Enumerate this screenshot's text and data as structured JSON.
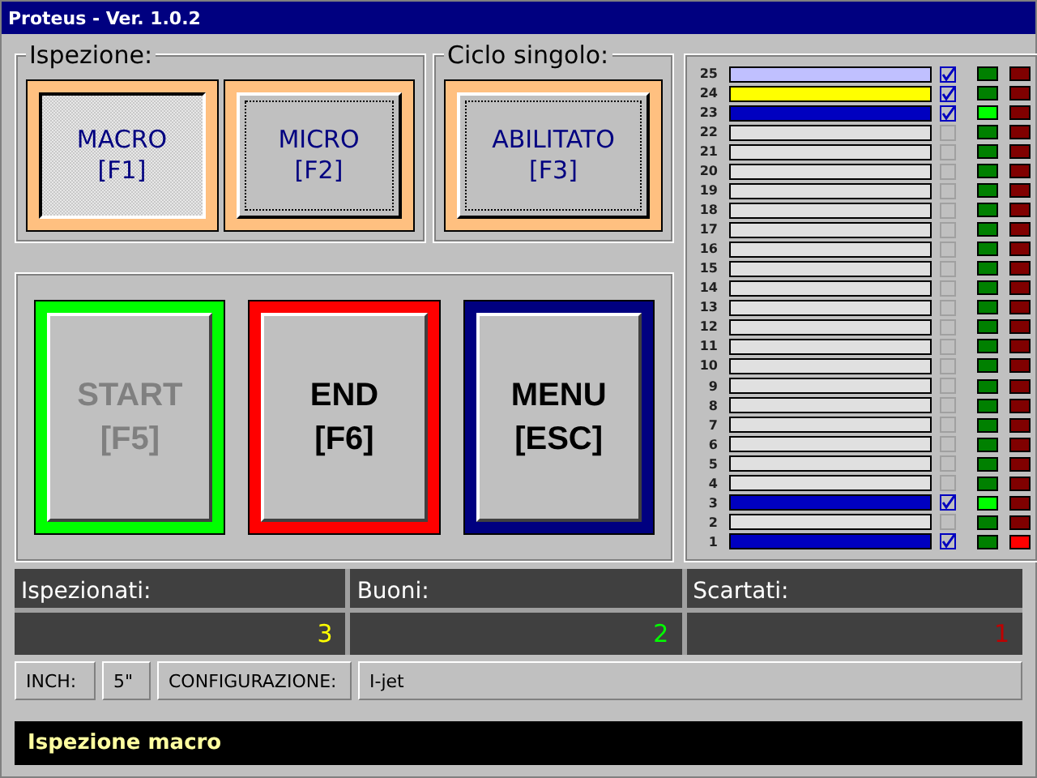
{
  "window": {
    "title": "Proteus - Ver. 1.0.2"
  },
  "inspection": {
    "label": "Ispezione:",
    "buttons": [
      {
        "label": "MACRO",
        "key": "[F1]",
        "selected": true
      },
      {
        "label": "MICRO",
        "key": "[F2]",
        "selected": false
      }
    ]
  },
  "single_cycle": {
    "label": "Ciclo singolo:",
    "button": {
      "label": "ABILITATO",
      "key": "[F3]"
    }
  },
  "actions": [
    {
      "label": "START",
      "key": "[F5]",
      "color": "#00ff00",
      "disabled": true
    },
    {
      "label": "END",
      "key": "[F6]",
      "color": "#ff0000",
      "disabled": false
    },
    {
      "label": "MENU",
      "key": "[ESC]",
      "color": "#000080",
      "disabled": false
    }
  ],
  "channels": [
    {
      "name": "25",
      "color": "#c0c0ff",
      "checked": true,
      "ok": false,
      "fail": false
    },
    {
      "name": "24",
      "color": "#ffff00",
      "checked": true,
      "ok": false,
      "fail": false
    },
    {
      "name": "23",
      "color": "#0000c0",
      "checked": true,
      "ok": true,
      "fail": false
    },
    {
      "name": "22",
      "color": "#e0e0e0",
      "checked": false,
      "ok": false,
      "fail": false
    },
    {
      "name": "21",
      "color": "#e0e0e0",
      "checked": false,
      "ok": false,
      "fail": false
    },
    {
      "name": "20",
      "color": "#e0e0e0",
      "checked": false,
      "ok": false,
      "fail": false
    },
    {
      "name": "19",
      "color": "#e0e0e0",
      "checked": false,
      "ok": false,
      "fail": false
    },
    {
      "name": "18",
      "color": "#e0e0e0",
      "checked": false,
      "ok": false,
      "fail": false
    },
    {
      "name": "17",
      "color": "#e0e0e0",
      "checked": false,
      "ok": false,
      "fail": false
    },
    {
      "name": "16",
      "color": "#e0e0e0",
      "checked": false,
      "ok": false,
      "fail": false
    },
    {
      "name": "15",
      "color": "#e0e0e0",
      "checked": false,
      "ok": false,
      "fail": false
    },
    {
      "name": "14",
      "color": "#e0e0e0",
      "checked": false,
      "ok": false,
      "fail": false
    },
    {
      "name": "13",
      "color": "#e0e0e0",
      "checked": false,
      "ok": false,
      "fail": false
    },
    {
      "name": "12",
      "color": "#e0e0e0",
      "checked": false,
      "ok": false,
      "fail": false
    },
    {
      "name": "11",
      "color": "#e0e0e0",
      "checked": false,
      "ok": false,
      "fail": false
    },
    {
      "name": "10",
      "color": "#e0e0e0",
      "checked": false,
      "ok": false,
      "fail": false
    },
    {
      "name": "9",
      "color": "#e0e0e0",
      "checked": false,
      "ok": false,
      "fail": false
    },
    {
      "name": "8",
      "color": "#e0e0e0",
      "checked": false,
      "ok": false,
      "fail": false
    },
    {
      "name": "7",
      "color": "#e0e0e0",
      "checked": false,
      "ok": false,
      "fail": false
    },
    {
      "name": "6",
      "color": "#e0e0e0",
      "checked": false,
      "ok": false,
      "fail": false
    },
    {
      "name": "5",
      "color": "#e0e0e0",
      "checked": false,
      "ok": false,
      "fail": false
    },
    {
      "name": "4",
      "color": "#e0e0e0",
      "checked": false,
      "ok": false,
      "fail": false
    },
    {
      "name": "3",
      "color": "#0000c0",
      "checked": true,
      "ok": true,
      "fail": false
    },
    {
      "name": "2",
      "color": "#e0e0e0",
      "checked": false,
      "ok": false,
      "fail": false
    },
    {
      "name": "1",
      "color": "#0000c0",
      "checked": true,
      "ok": false,
      "fail": true
    }
  ],
  "counters": [
    {
      "label": "Ispezionati:",
      "value": "3",
      "color": "#ffff00"
    },
    {
      "label": "Buoni:",
      "value": "2",
      "color": "#00ff00"
    },
    {
      "label": "Scartati:",
      "value": "1",
      "color": "#c00000"
    }
  ],
  "info": {
    "inch_label": "INCH:",
    "inch_value": "5\"",
    "config_label": "CONFIGURAZIONE:",
    "config_value": "I-jet"
  },
  "status_bar": "Ispezione macro"
}
